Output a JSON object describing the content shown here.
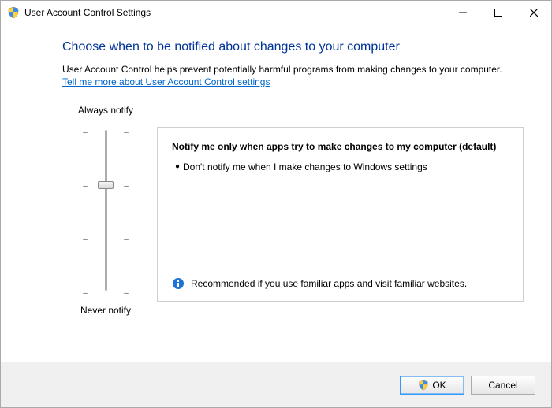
{
  "titlebar": {
    "title": "User Account Control Settings"
  },
  "heading": "Choose when to be notified about changes to your computer",
  "description": "User Account Control helps prevent potentially harmful programs from making changes to your computer.",
  "link_text": "Tell me more about User Account Control settings",
  "slider": {
    "top_label": "Always notify",
    "bottom_label": "Never notify",
    "levels": 4,
    "selected_index": 1
  },
  "info": {
    "heading": "Notify me only when apps try to make changes to my computer (default)",
    "bullet": "Don't notify me when I make changes to Windows settings",
    "recommendation": "Recommended if you use familiar apps and visit familiar websites."
  },
  "buttons": {
    "ok": "OK",
    "cancel": "Cancel"
  }
}
